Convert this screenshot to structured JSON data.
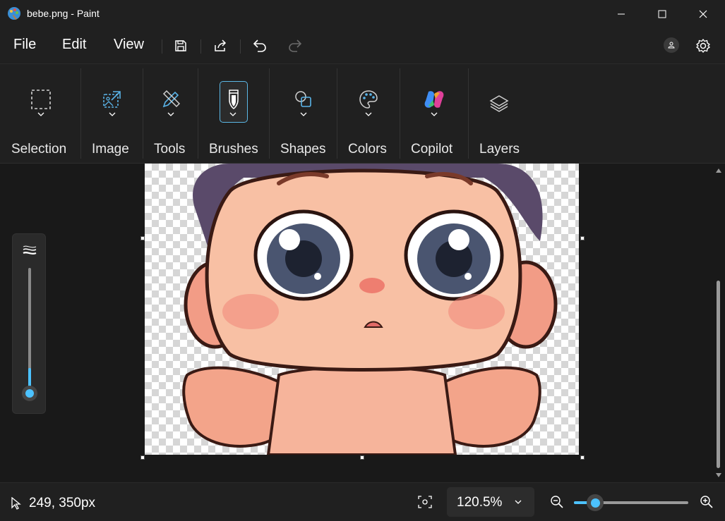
{
  "window": {
    "title": "bebe.png - Paint",
    "app_icon": "paint-palette-icon",
    "controls": [
      "minimize-icon",
      "maximize-icon",
      "close-icon"
    ]
  },
  "menu": {
    "items": [
      "File",
      "Edit",
      "View"
    ],
    "quick_actions": [
      "save-icon",
      "share-icon",
      "undo-icon",
      "redo-icon"
    ],
    "right_icons": [
      "account-icon",
      "settings-icon"
    ]
  },
  "ribbon": {
    "groups": [
      {
        "label": "Selection",
        "icon": "selection-rectangle-icon",
        "has_dropdown": true
      },
      {
        "label": "Image",
        "icon": "image-crop-icon",
        "has_dropdown": true
      },
      {
        "label": "Tools",
        "icon": "pencil-eraser-icon",
        "has_dropdown": true
      },
      {
        "label": "Brushes",
        "icon": "brush-icon",
        "has_dropdown": true,
        "active": true
      },
      {
        "label": "Shapes",
        "icon": "shapes-icon",
        "has_dropdown": true
      },
      {
        "label": "Colors",
        "icon": "palette-icon",
        "has_dropdown": true
      },
      {
        "label": "Copilot",
        "icon": "copilot-icon",
        "has_dropdown": true
      },
      {
        "label": "Layers",
        "icon": "layers-icon",
        "has_dropdown": false
      }
    ]
  },
  "canvas": {
    "image_subject": "baby-cartoon-image",
    "background": "transparent-checkerboard"
  },
  "brush_size": {
    "icon": "brush-size-icon",
    "level_fraction": 0.05
  },
  "status": {
    "cursor_icon": "pointer-icon",
    "coordinates": "249, 350px",
    "fit_icon": "fit-to-window-icon",
    "zoom_value": "120.5%",
    "zoom_out_icon": "zoom-out-icon",
    "zoom_in_icon": "zoom-in-icon",
    "zoom_slider_fraction": 0.19
  },
  "colors": {
    "accent": "#4cc2ff",
    "background": "#1c1c1c",
    "panel": "#202020"
  }
}
